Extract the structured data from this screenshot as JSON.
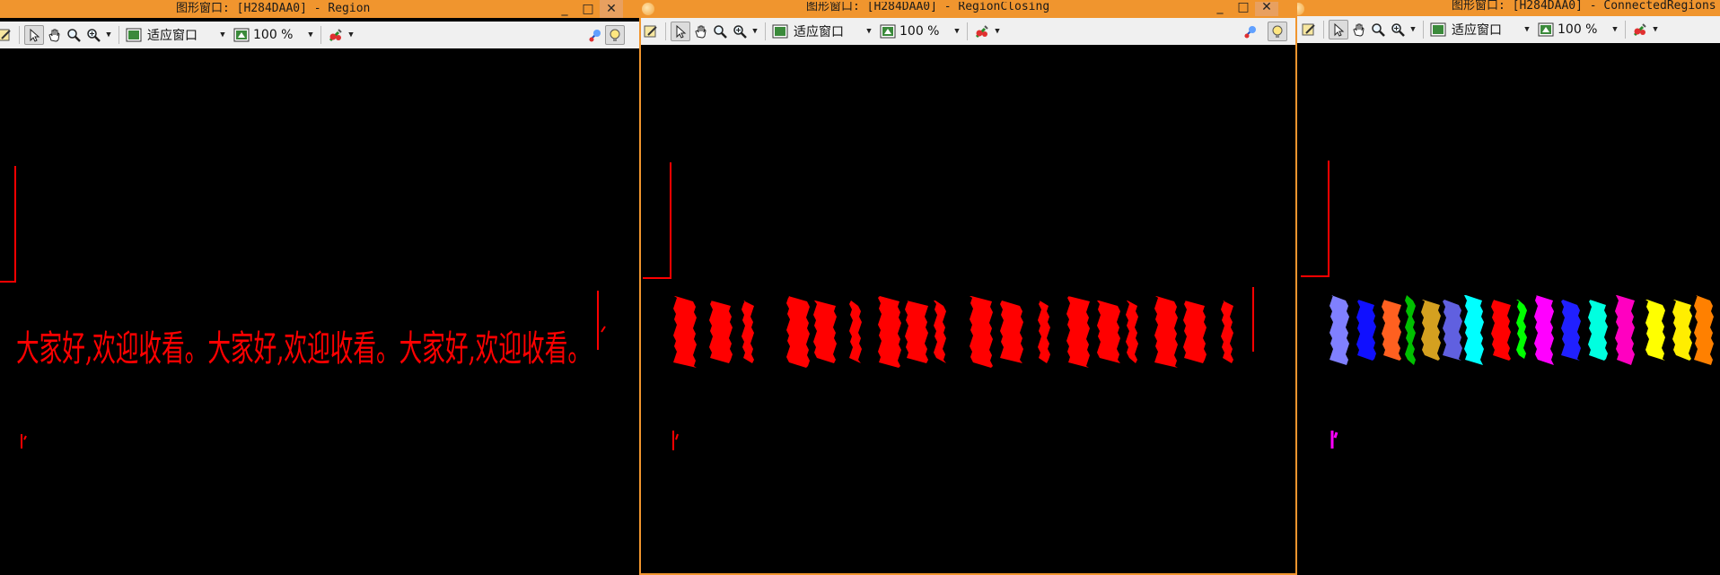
{
  "windows": [
    {
      "id": "region",
      "title": "图形窗口: [H284DAA0] - Region",
      "zoom_mode": "适应窗口",
      "zoom_percent": "100 %",
      "colors": [
        "#ff0000"
      ],
      "overlay_text": "大家好,欢迎收看。大家好,欢迎收看。大家好,欢迎收看。"
    },
    {
      "id": "region-closing",
      "title": "图形窗口: [H284DAA0] - RegionClosing",
      "zoom_mode": "适应窗口",
      "zoom_percent": "100 %",
      "colors": [
        "#ff0000"
      ]
    },
    {
      "id": "connected-regions",
      "title": "图形窗口: [H284DAA0] - ConnectedRegions",
      "zoom_mode": "适应窗口",
      "zoom_percent": "100 %",
      "colors": [
        "#8080ff",
        "#1010ff",
        "#ff6020",
        "#00c000",
        "#d4a020",
        "#6060e0",
        "#00ffff",
        "#ff0000",
        "#00ff00",
        "#ff00ff",
        "#2020ff",
        "#00ffe0",
        "#ff00c0",
        "#ffff00",
        "#ffee00",
        "#ff8000"
      ]
    }
  ],
  "window_controls": {
    "minimize": "_",
    "maximize": "□",
    "close": "✕"
  }
}
